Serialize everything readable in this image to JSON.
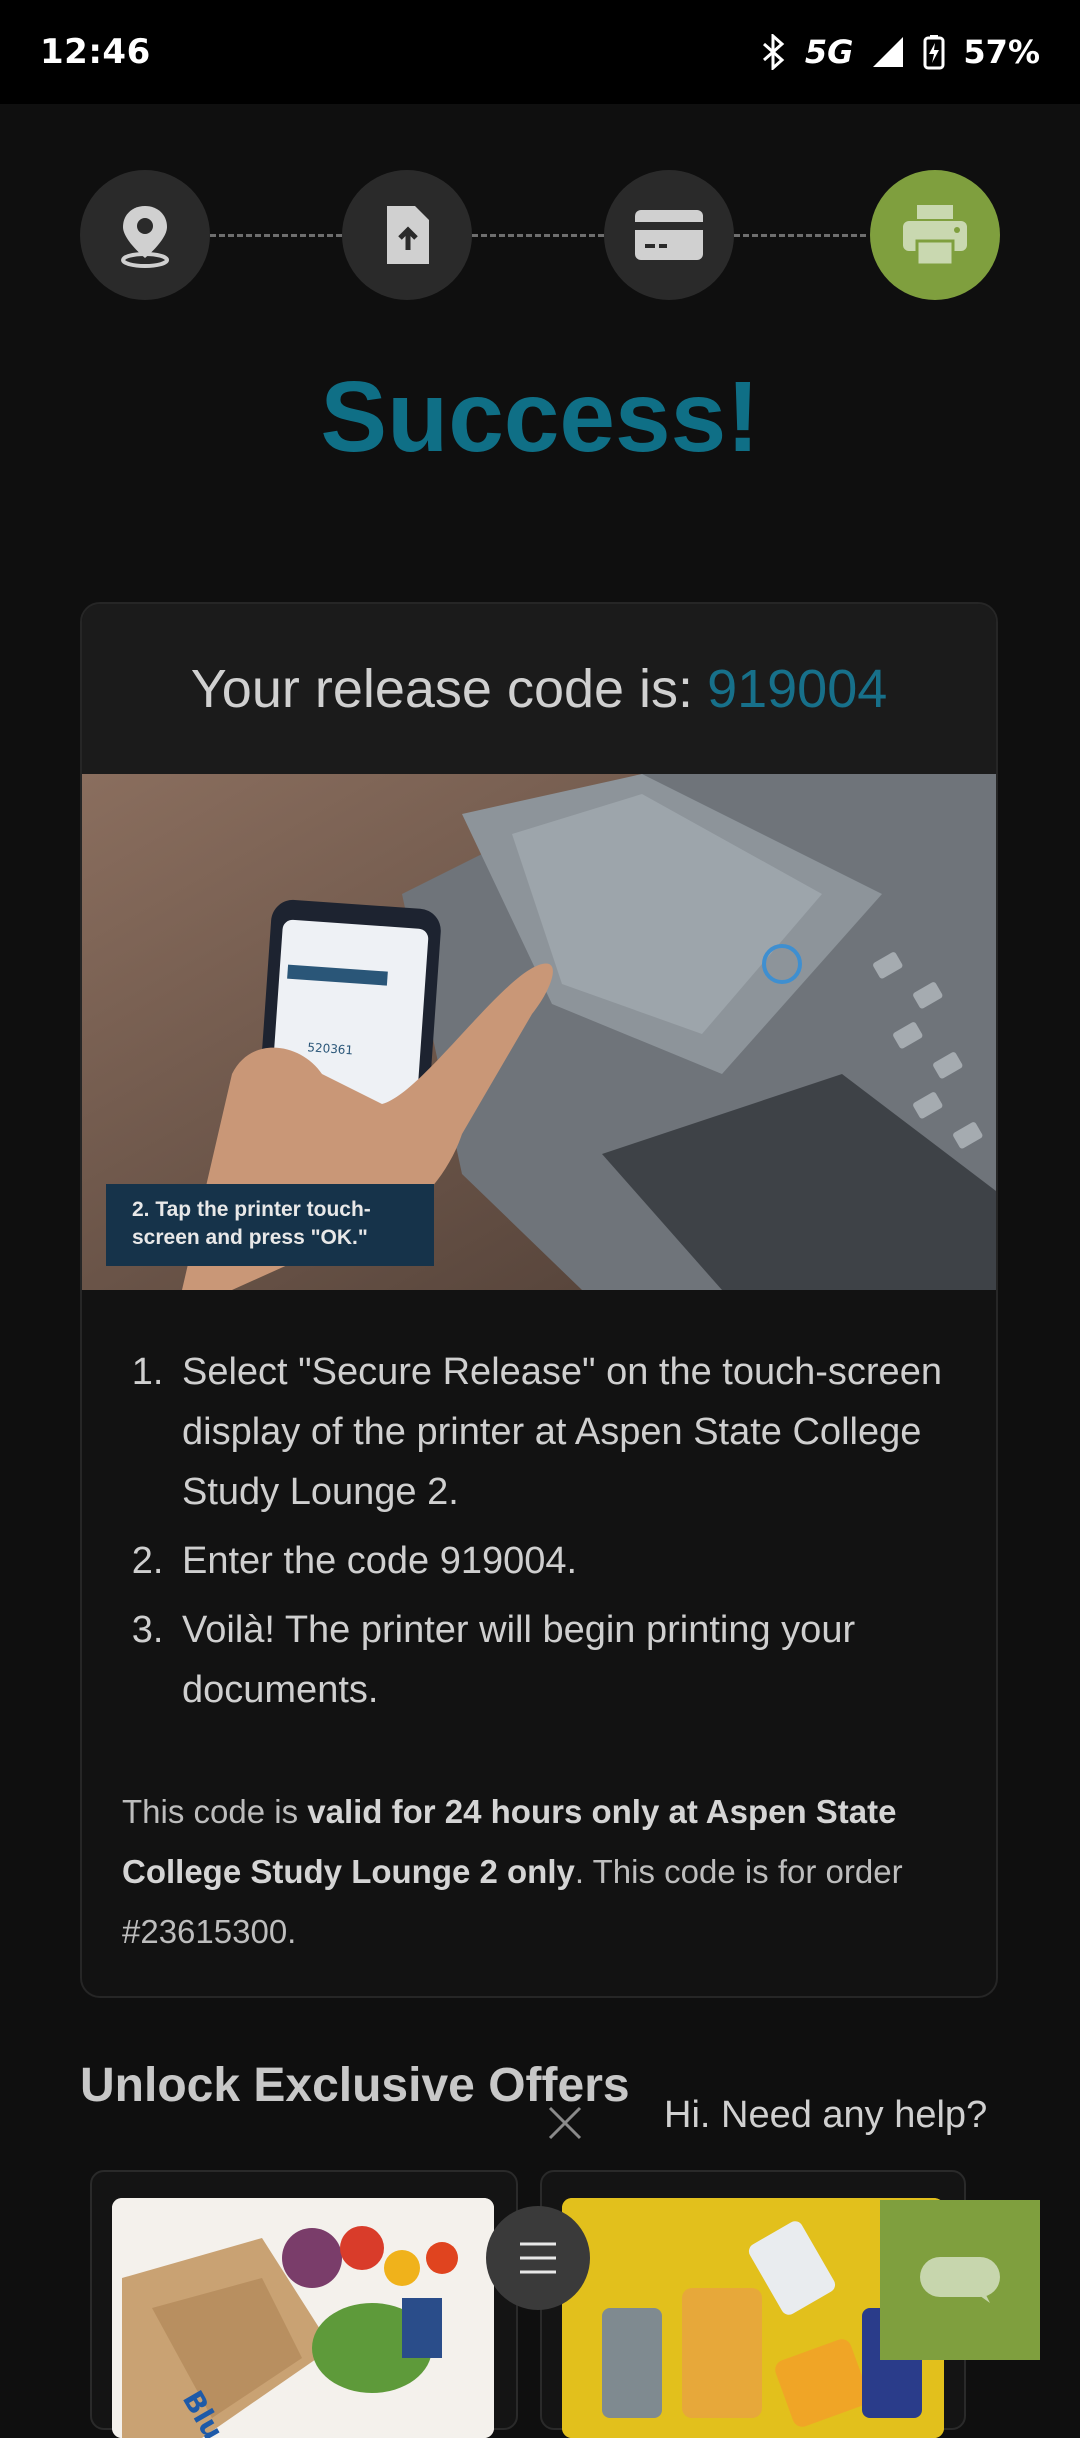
{
  "status_bar": {
    "time": "12:46",
    "network": "5G",
    "battery": "57%",
    "icons": [
      "bluetooth-icon",
      "signal-icon",
      "battery-charging-icon"
    ]
  },
  "stepper": {
    "steps": [
      {
        "icon": "location-pin-icon",
        "state": "done"
      },
      {
        "icon": "file-upload-icon",
        "state": "done"
      },
      {
        "icon": "credit-card-icon",
        "state": "done"
      },
      {
        "icon": "printer-icon",
        "state": "active"
      }
    ]
  },
  "title": "Success!",
  "release": {
    "label": "Your release code is:",
    "code": "919004"
  },
  "photo": {
    "caption_line1": "2. Tap the printer touch-",
    "caption_line2": "screen and press \"OK.\"",
    "phone_code": "520361"
  },
  "instructions": [
    "Select \"Secure Release\" on the touch-screen display of the printer at Aspen State College Study Lounge 2.",
    "Enter the code 919004.",
    "Voilà! The printer will begin printing your documents."
  ],
  "note": {
    "prefix": "This code is ",
    "bold": "valid for 24 hours only at Aspen State College Study Lounge 2 only",
    "suffix": ". This code is for order #23615300."
  },
  "offers": {
    "heading": "Unlock Exclusive Offers",
    "brand1": "Blue Apron"
  },
  "help": {
    "bubble_text": "Hi. Need any help?"
  },
  "colors": {
    "accent_teal": "#0f6f86",
    "accent_green": "#7f9f3e",
    "background": "#0f0f0f"
  }
}
